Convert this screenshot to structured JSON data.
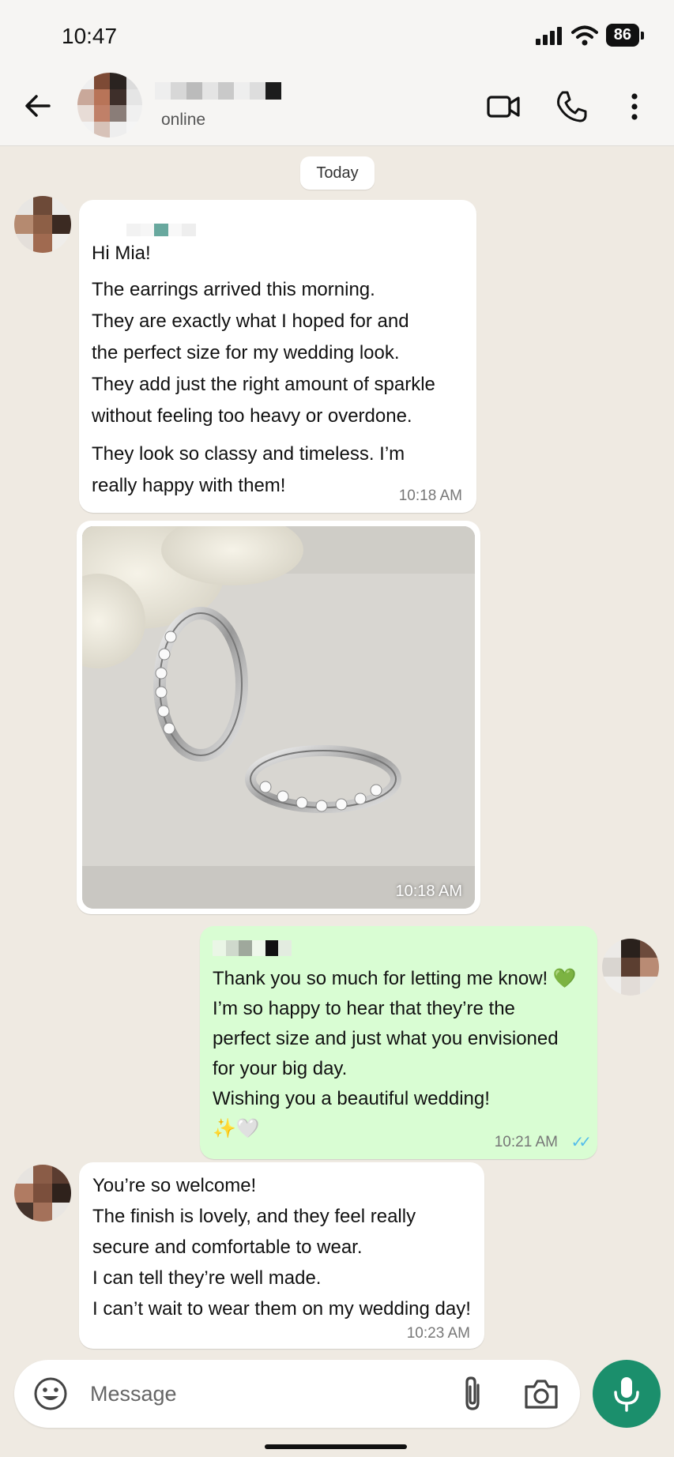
{
  "status_bar": {
    "time": "10:47",
    "battery": "86"
  },
  "header": {
    "contact_status": "online"
  },
  "chat": {
    "date_chip": "Today",
    "messages": [
      {
        "direction": "incoming",
        "lines": [
          "Hi Mia!",
          "The earrings arrived this morning.",
          "They are exactly what I hoped for and",
          "the perfect size for my wedding look.",
          "They add just the right amount of sparkle",
          "without feeling too heavy or overdone.",
          "They look so classy and timeless. I’m",
          "really happy with them!"
        ],
        "time": "10:18 AM"
      },
      {
        "direction": "incoming",
        "type": "photo",
        "time": "10:18 AM"
      },
      {
        "direction": "outgoing",
        "lines": [
          "Thank you so much for letting me know! 💚",
          "I’m so happy to hear that they’re the",
          "perfect size and just what you envisioned",
          "for your big day.",
          "Wishing you a beautiful wedding!",
          "✨🤍"
        ],
        "time": "10:21 AM",
        "read_receipt": "✓✓"
      },
      {
        "direction": "incoming",
        "lines": [
          "You’re so welcome!",
          "The finish is lovely, and they feel really",
          "secure and comfortable to wear.",
          "I can tell they’re well made.",
          "I can’t wait to wear them on my wedding day!"
        ],
        "time": "10:23 AM"
      }
    ]
  },
  "composer": {
    "placeholder": "Message"
  },
  "colors": {
    "outgoing_bubble": "#d9fdd3",
    "incoming_bubble": "#ffffff",
    "accent": "#1b8f6c",
    "read_receipt": "#53bdeb"
  },
  "icons": [
    "back-arrow-icon",
    "video-call-icon",
    "phone-icon",
    "more-options-icon",
    "emoji-icon",
    "attach-icon",
    "camera-icon",
    "mic-icon",
    "signal-icon",
    "wifi-icon"
  ]
}
